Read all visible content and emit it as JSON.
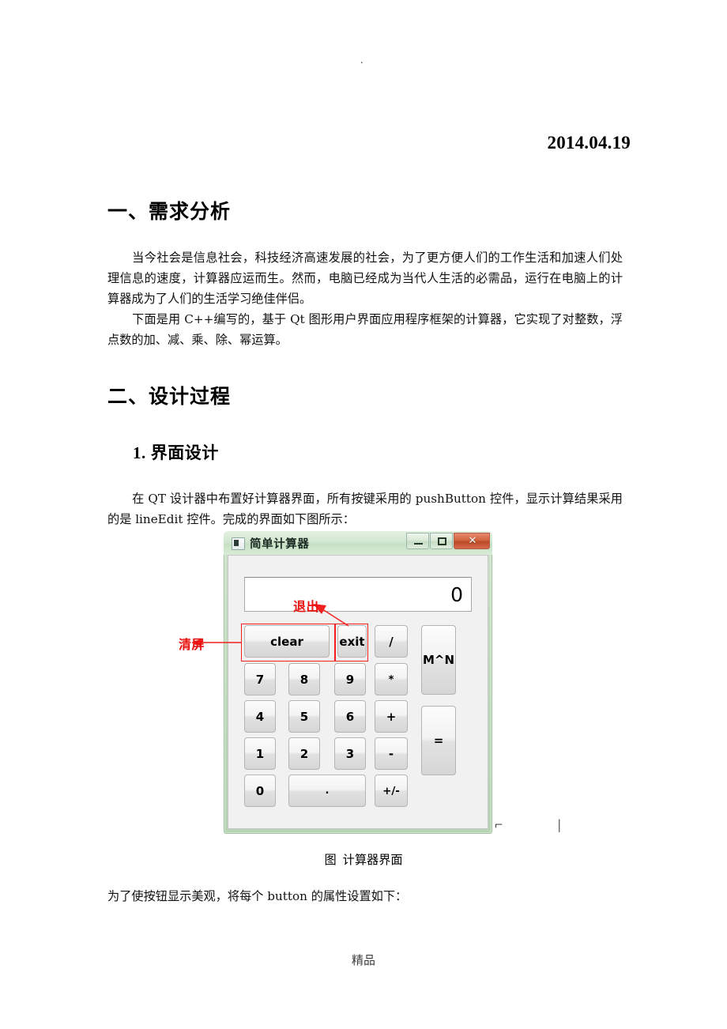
{
  "document": {
    "top_mark": ".",
    "date": "2014.04.19",
    "footer": "精品"
  },
  "sections": [
    {
      "heading": "一、需求分析",
      "paragraphs": [
        "当今社会是信息社会，科技经济高速发展的社会，为了更方便人们的工作生活和加速人们处理信息的速度，计算器应运而生。然而，电脑已经成为当代人生活的必需品，运行在电脑上的计算器成为了人们的生活学习绝佳伴侣。",
        "下面是用 C++编写的，基于 Qt 图形用户界面应用程序框架的计算器，它实现了对整数，浮点数的加、减、乘、除、幂运算。"
      ]
    },
    {
      "heading": "二、设计过程",
      "subheading_number": "1.",
      "subheading": "界面设计",
      "paragraphs": [
        "在 QT 设计器中布置好计算器界面，所有按键采用的 pushButton 控件，显示计算结果采用的是 lineEdit 控件。完成的界面如下图所示："
      ]
    }
  ],
  "figure": {
    "caption_label": "图",
    "caption_text": "计算器界面",
    "below_text": "为了使按钮显示美观，将每个 button 的属性设置如下："
  },
  "calculator": {
    "window_title": "简单计算器",
    "titlebar_buttons": {
      "minimize": "minimize",
      "maximize": "maximize",
      "close": "✕"
    },
    "display_value": "0",
    "buttons": [
      {
        "label": "clear",
        "name": "clear-button"
      },
      {
        "label": "exit",
        "name": "exit-button"
      },
      {
        "label": "/",
        "name": "divide-button"
      },
      {
        "label": "M^N",
        "name": "power-button"
      },
      {
        "label": "7",
        "name": "digit-7-button"
      },
      {
        "label": "8",
        "name": "digit-8-button"
      },
      {
        "label": "9",
        "name": "digit-9-button"
      },
      {
        "label": "*",
        "name": "multiply-button"
      },
      {
        "label": "4",
        "name": "digit-4-button"
      },
      {
        "label": "5",
        "name": "digit-5-button"
      },
      {
        "label": "6",
        "name": "digit-6-button"
      },
      {
        "label": "+",
        "name": "plus-button"
      },
      {
        "label": "1",
        "name": "digit-1-button"
      },
      {
        "label": "2",
        "name": "digit-2-button"
      },
      {
        "label": "3",
        "name": "digit-3-button"
      },
      {
        "label": "-",
        "name": "minus-button"
      },
      {
        "label": "=",
        "name": "equals-button"
      },
      {
        "label": "0",
        "name": "digit-0-button"
      },
      {
        "label": ".",
        "name": "decimal-point-button"
      },
      {
        "label": "+/-",
        "name": "sign-toggle-button"
      }
    ],
    "annotations": [
      {
        "text": "清屏",
        "target": "clear-button",
        "color": "#e8110f"
      },
      {
        "text": "退出",
        "target": "exit-button",
        "color": "#e8110f"
      }
    ]
  },
  "stray_marks": [
    "⌐",
    "|"
  ]
}
